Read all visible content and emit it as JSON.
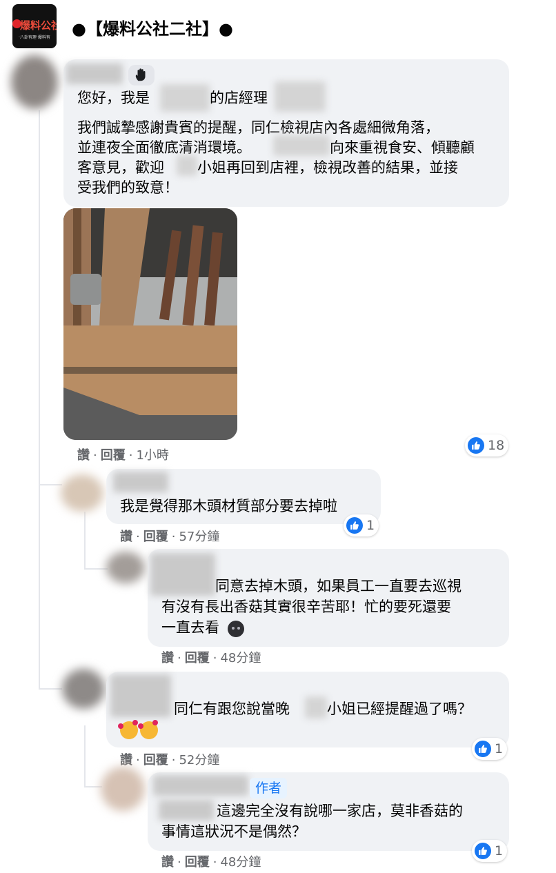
{
  "group": {
    "logo_text": "爆料公社",
    "logo_sub": "·八卦有理·爆料有",
    "name": "●【爆料公社二社】●"
  },
  "comments": [
    {
      "lines": [
        "您好，我是",
        "的店經理",
        "我們誠摯感謝貴賓的提醒，同仁檢視店內各處細微角落，",
        "並連夜全面徹底清消環境。",
        "向來重視食安、傾聽顧",
        "客意見，歡迎",
        "小姐再回到店裡，檢視改善的結果，並接",
        "受我們的致意！"
      ],
      "actions": {
        "like": "讚",
        "reply": "回覆",
        "time": "1小時"
      },
      "reactions": "18"
    },
    {
      "lines": [
        "我是覺得那木頭材質部分要去掉啦"
      ],
      "actions": {
        "like": "讚",
        "reply": "回覆",
        "time": "57分鐘"
      },
      "reactions": "1"
    },
    {
      "lines": [
        "同意去掉木頭，如果員工一直要去巡視",
        "有沒有長出香菇其實很辛苦耶！忙的要死還要",
        "一直去看"
      ],
      "actions": {
        "like": "讚",
        "reply": "回覆",
        "time": "48分鐘"
      }
    },
    {
      "lines": [
        "同仁有跟您說當晚",
        "小姐已經提醒過了嗎？"
      ],
      "actions": {
        "like": "讚",
        "reply": "回覆",
        "time": "52分鐘"
      },
      "reactions": "1"
    },
    {
      "author_badge": "作者",
      "lines": [
        "這邊完全沒有說哪一家店，莫非香菇的",
        "事情這狀況不是偶然？"
      ],
      "actions": {
        "like": "讚",
        "reply": "回覆",
        "time": "48分鐘"
      },
      "reactions": "1"
    }
  ],
  "separator": "·",
  "icons": [
    "wave-hand-icon",
    "like-icon",
    "dark-face-emoji-icon",
    "smiling-face-with-hearts-icon"
  ],
  "colors": {
    "like_blue": "#1877f2",
    "bubble_bg": "#f0f2f5",
    "meta_gray": "#65676b"
  }
}
